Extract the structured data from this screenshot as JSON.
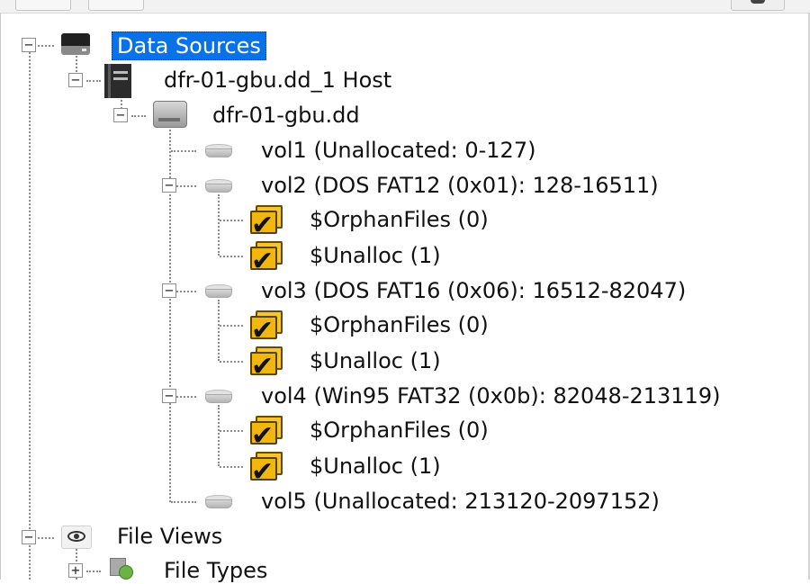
{
  "tree": {
    "data_sources": {
      "label": "Data Sources",
      "icon": "drive-icon"
    },
    "host": {
      "label": "dfr-01-gbu.dd_1 Host",
      "icon": "server-icon"
    },
    "image": {
      "label": "dfr-01-gbu.dd",
      "icon": "disk-image-icon"
    },
    "volumes": [
      {
        "label": "vol1 (Unallocated: 0-127)"
      },
      {
        "label": "vol2 (DOS FAT12 (0x01): 128-16511)",
        "children": [
          {
            "label": "$OrphanFiles (0)"
          },
          {
            "label": "$Unalloc (1)"
          }
        ]
      },
      {
        "label": "vol3 (DOS FAT16 (0x06): 16512-82047)",
        "children": [
          {
            "label": "$OrphanFiles (0)"
          },
          {
            "label": "$Unalloc (1)"
          }
        ]
      },
      {
        "label": "vol4 (Win95 FAT32 (0x0b): 82048-213119)",
        "children": [
          {
            "label": "$OrphanFiles (0)"
          },
          {
            "label": "$Unalloc (1)"
          }
        ]
      },
      {
        "label": "vol5 (Unallocated: 213120-2097152)"
      }
    ],
    "file_views": {
      "label": "File Views",
      "icon": "eye-icon"
    },
    "file_types": {
      "label": "File Types",
      "icon": "file-types-icon"
    }
  },
  "expander": {
    "collapse": "−",
    "expand": "+"
  },
  "colors": {
    "selection": "#0a72e8",
    "folder": "#f2b70e"
  }
}
